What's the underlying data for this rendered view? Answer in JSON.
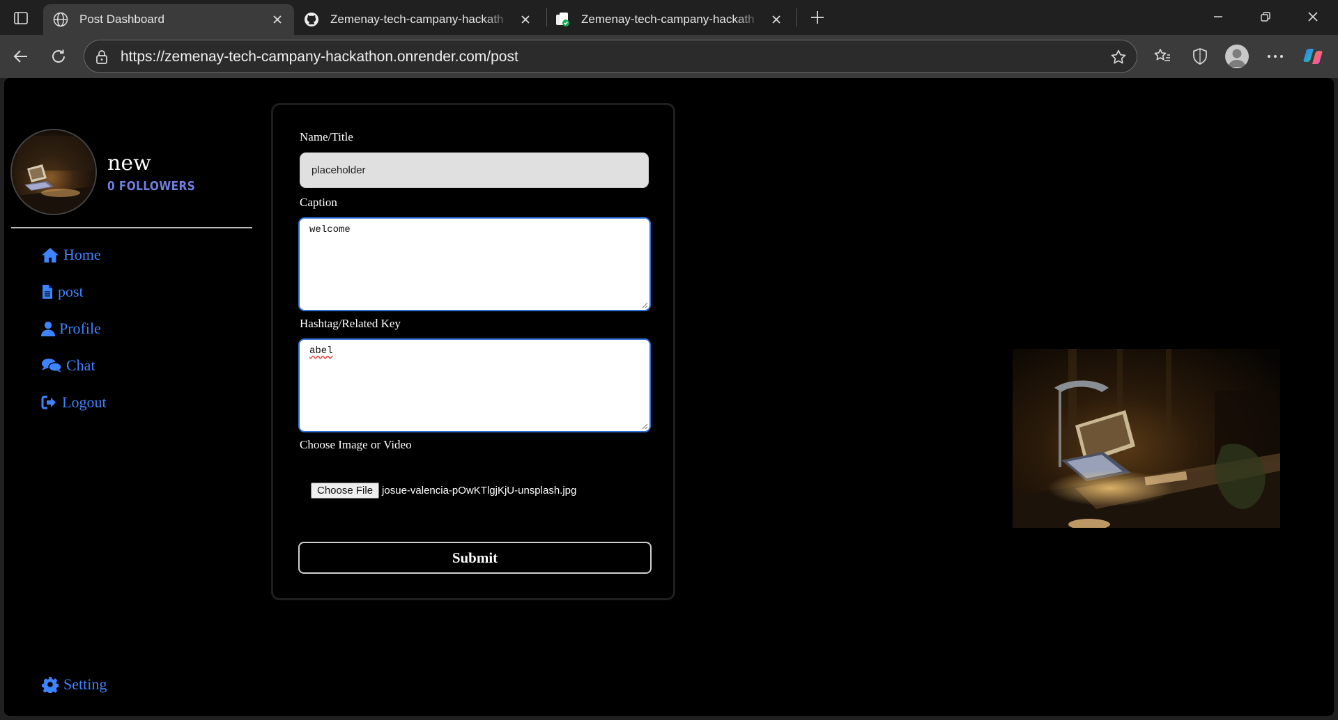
{
  "browser": {
    "tabs": [
      {
        "title": "Post Dashboard",
        "icon": "globe-icon",
        "active": true
      },
      {
        "title": "Zemenay-tech-campany-hackath",
        "icon": "github-icon",
        "active": false
      },
      {
        "title": "Zemenay-tech-campany-hackath",
        "icon": "render-icon",
        "active": false
      }
    ],
    "url": "https://zemenay-tech-campany-hackathon.onrender.com/post"
  },
  "sidebar": {
    "user_name": "new",
    "followers": "0 FOLLOWERS",
    "nav": [
      {
        "label": "Home",
        "icon": "home-icon"
      },
      {
        "label": "post",
        "icon": "file-icon"
      },
      {
        "label": "Profile",
        "icon": "user-icon"
      },
      {
        "label": "Chat",
        "icon": "chat-icon"
      },
      {
        "label": "Logout",
        "icon": "logout-icon"
      }
    ],
    "setting_label": "Setting"
  },
  "form": {
    "title_label": "Name/Title",
    "title_value": "placeholder",
    "caption_label": "Caption",
    "caption_value": "welcome",
    "hashtag_label": "Hashtag/Related Key",
    "hashtag_value": "abel",
    "file_label": "Choose Image or Video",
    "file_button": "Choose File",
    "file_name": "josue-valencia-pOwKTlgjKjU-unsplash.jpg",
    "submit_label": "Submit"
  },
  "colors": {
    "accent_nav": "#3d84ff",
    "followers": "#6f7fe0",
    "page_bg": "#000000"
  }
}
